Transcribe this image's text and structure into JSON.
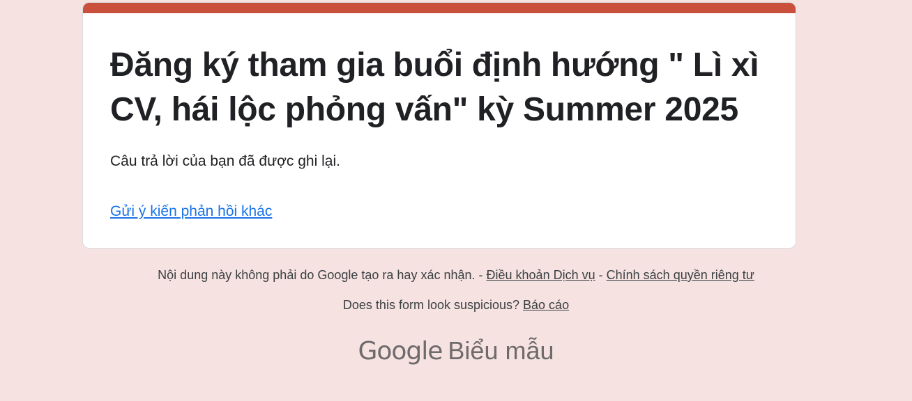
{
  "form": {
    "title": "Đăng ký tham gia buổi định hướng \" Lì xì CV, hái lộc phỏng vấn\" kỳ Summer 2025",
    "confirmation_message": "Câu trả lời của bạn đã được ghi lại.",
    "submit_another_link": "Gửi ý kiến phản hồi khác"
  },
  "footer": {
    "disclaimer_text": "Nội dung này không phải do Google tạo ra hay xác nhận. -",
    "separator": "-",
    "terms_link": "Điều khoản Dịch vụ",
    "privacy_link": "Chính sách quyền riêng tư",
    "suspicious_text": "Does this form look suspicious?",
    "report_link": "Báo cáo"
  },
  "brand": {
    "google": "Google",
    "product": "Biểu mẫu"
  },
  "colors": {
    "accent": "#c9503d",
    "background": "#f5e2e1",
    "link": "#1a73e8"
  }
}
